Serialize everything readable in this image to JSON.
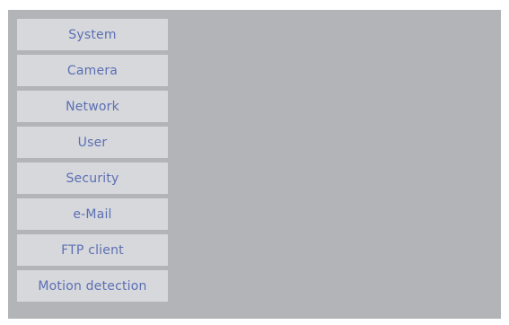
{
  "menu": {
    "items": [
      {
        "label": "System"
      },
      {
        "label": "Camera"
      },
      {
        "label": "Network"
      },
      {
        "label": "User"
      },
      {
        "label": "Security"
      },
      {
        "label": "e-Mail"
      },
      {
        "label": "FTP client"
      },
      {
        "label": "Motion detection"
      }
    ]
  },
  "colors": {
    "panel_background": "#b2b4b7",
    "menu_item_background": "#d7d8dc",
    "menu_item_text": "#5b6fb3"
  }
}
